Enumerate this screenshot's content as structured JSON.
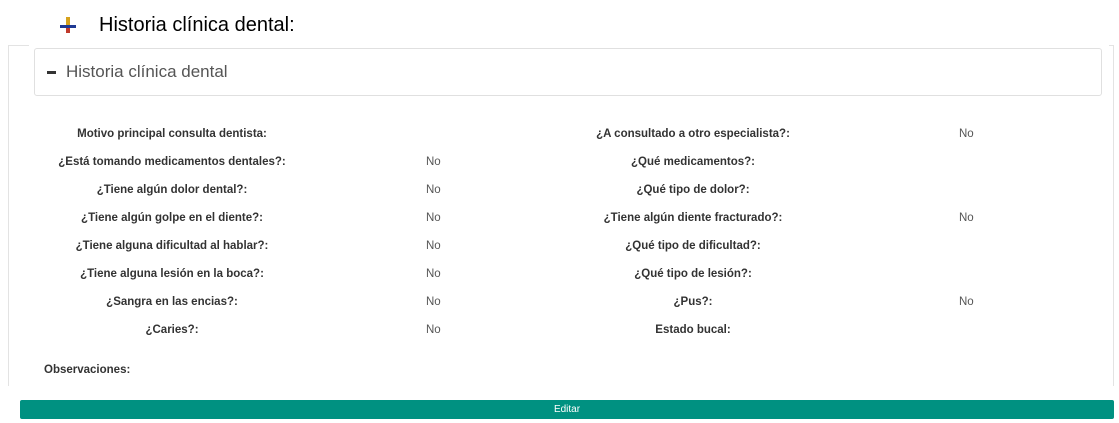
{
  "doc_heading": "Historia clínica dental:",
  "panel": {
    "title": "Historia clínica dental",
    "toggle_icon": "minus-icon"
  },
  "fields": [
    {
      "left_label": "Motivo principal consulta dentista:",
      "left_value": "",
      "right_label": "¿A consultado a otro especialista?:",
      "right_value": "No"
    },
    {
      "left_label": "¿Está tomando medicamentos dentales?:",
      "left_value": "No",
      "right_label": "¿Qué medicamentos?:",
      "right_value": ""
    },
    {
      "left_label": "¿Tiene algún dolor dental?:",
      "left_value": "No",
      "right_label": "¿Qué tipo de dolor?:",
      "right_value": ""
    },
    {
      "left_label": "¿Tiene algún golpe en el diente?:",
      "left_value": "No",
      "right_label": "¿Tiene algún diente fracturado?:",
      "right_value": "No"
    },
    {
      "left_label": "¿Tiene alguna dificultad al hablar?:",
      "left_value": "No",
      "right_label": "¿Qué tipo de dificultad?:",
      "right_value": ""
    },
    {
      "left_label": "¿Tiene alguna lesión en la boca?:",
      "left_value": "No",
      "right_label": "¿Qué tipo de lesión?:",
      "right_value": ""
    },
    {
      "left_label": "¿Sangra en las encias?:",
      "left_value": "No",
      "right_label": "¿Pus?:",
      "right_value": "No"
    },
    {
      "left_label": "¿Caries?:",
      "left_value": "No",
      "right_label": "Estado bucal:",
      "right_value": ""
    }
  ],
  "observations_label": "Observaciones:",
  "edit_button": "Editar",
  "colors": {
    "button": "#009181"
  }
}
